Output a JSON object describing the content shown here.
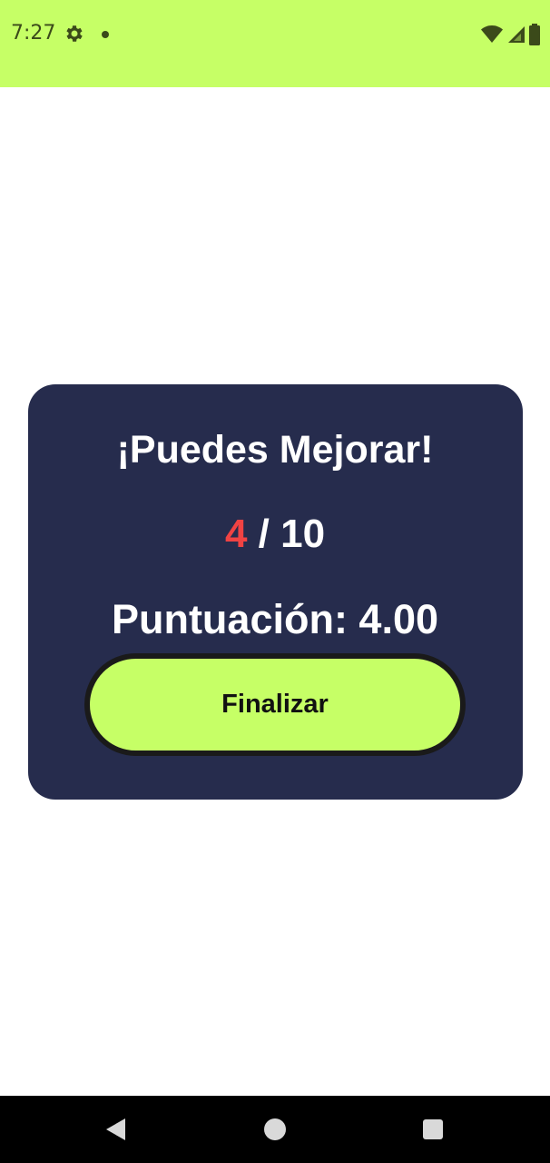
{
  "status_bar": {
    "time": "7:27",
    "background": "#c6ff66",
    "icons": [
      "gear-icon",
      "notification-dot-icon",
      "wifi-icon",
      "cellular-signal-icon",
      "battery-icon"
    ]
  },
  "result_card": {
    "title": "¡Puedes Mejorar!",
    "score_correct": "4",
    "score_separator": " / ",
    "score_total": "10",
    "puntuacion_text": "Puntuación: 4.00",
    "finish_button_label": "Finalizar",
    "card_color": "#262c4d",
    "correct_color": "#f04343",
    "button_color": "#c6ff66"
  },
  "nav_bar": {
    "icons": [
      "back-icon",
      "home-icon",
      "recents-icon"
    ]
  }
}
